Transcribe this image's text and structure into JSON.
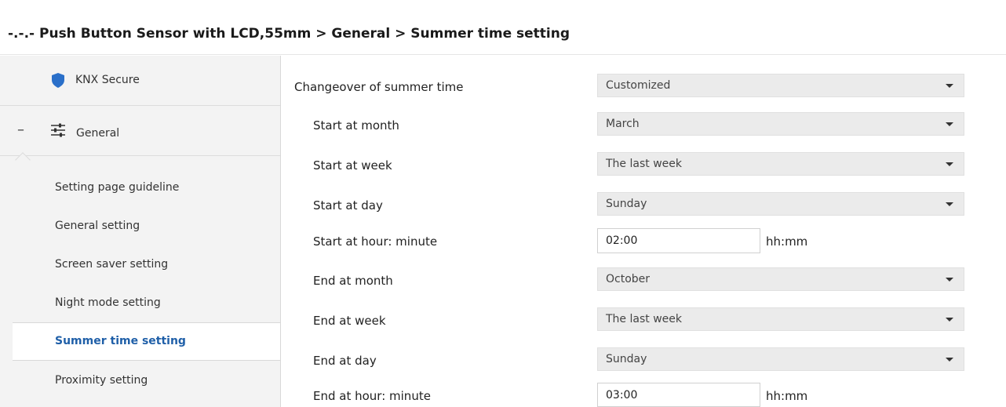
{
  "breadcrumb": "-.-.- Push Button Sensor with LCD,55mm > General > Summer time setting",
  "sidebar": {
    "knx_secure": {
      "label": "KNX Secure",
      "icon": "shield-icon",
      "icon_color": "#2a6fc9"
    },
    "general": {
      "label": "General",
      "icon": "sliders-icon",
      "collapse": "–"
    },
    "items": [
      {
        "label": "Setting page guideline"
      },
      {
        "label": "General setting"
      },
      {
        "label": "Screen saver setting"
      },
      {
        "label": "Night mode setting"
      },
      {
        "label": "Summer time setting",
        "active": true
      },
      {
        "label": "Proximity setting"
      }
    ],
    "active_color": "#1f5fa8"
  },
  "params": [
    {
      "label": "Changeover of summer time",
      "type": "select",
      "value": "Customized"
    },
    {
      "label": "Start at month",
      "type": "select",
      "value": "March"
    },
    {
      "label": "Start at week",
      "type": "select",
      "value": "The last week"
    },
    {
      "label": "Start at day",
      "type": "select",
      "value": "Sunday"
    },
    {
      "label": "Start at hour: minute",
      "type": "text",
      "value": "02:00",
      "unit": "hh:mm"
    },
    {
      "label": "End at month",
      "type": "select",
      "value": "October"
    },
    {
      "label": "End at week",
      "type": "select",
      "value": "The last week"
    },
    {
      "label": "End at day",
      "type": "select",
      "value": "Sunday"
    },
    {
      "label": "End at hour: minute",
      "type": "text",
      "value": "03:00",
      "unit": "hh:mm"
    }
  ]
}
